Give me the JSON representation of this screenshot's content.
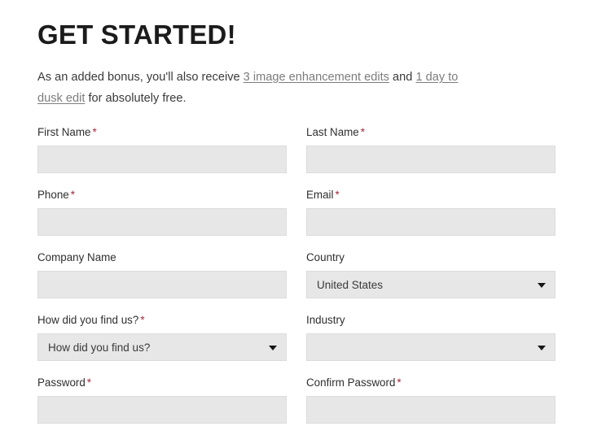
{
  "header": {
    "title": "GET STARTED!"
  },
  "intro": {
    "part1": "As an added bonus, you'll also receive ",
    "link1": "3 image enhancement edits",
    "part2": " and ",
    "link2": "1 day to dusk edit",
    "part3": " for absolutely free."
  },
  "colors": {
    "required_asterisk": "#a42a3c",
    "field_background": "#e7e7e7",
    "field_border": "#dcdcdc",
    "heading_text": "#1b1b1b",
    "label_text": "#2f2f2f",
    "link_text": "#7c7c7c"
  },
  "form": {
    "required_marker": "*",
    "rows": [
      {
        "left": {
          "label": "First Name",
          "required": "*",
          "type": "text",
          "value": "",
          "placeholder": ""
        },
        "right": {
          "label": "Last Name",
          "required": "*",
          "type": "text",
          "value": "",
          "placeholder": ""
        }
      },
      {
        "left": {
          "label": "Phone",
          "required": "*",
          "type": "text",
          "value": "",
          "placeholder": ""
        },
        "right": {
          "label": "Email",
          "required": "*",
          "type": "text",
          "value": "",
          "placeholder": ""
        }
      },
      {
        "left": {
          "label": "Company Name",
          "required": "",
          "type": "text",
          "value": "",
          "placeholder": ""
        },
        "right": {
          "label": "Country",
          "required": "",
          "type": "select",
          "value": "United States"
        }
      },
      {
        "left": {
          "label": "How did you find us?",
          "required": "*",
          "type": "select",
          "value": "How did you find us?"
        },
        "right": {
          "label": "Industry",
          "required": "",
          "type": "select",
          "value": ""
        }
      },
      {
        "left": {
          "label": "Password",
          "required": "*",
          "type": "text",
          "value": "",
          "placeholder": ""
        },
        "right": {
          "label": "Confirm Password",
          "required": "*",
          "type": "text",
          "value": "",
          "placeholder": ""
        }
      }
    ]
  }
}
